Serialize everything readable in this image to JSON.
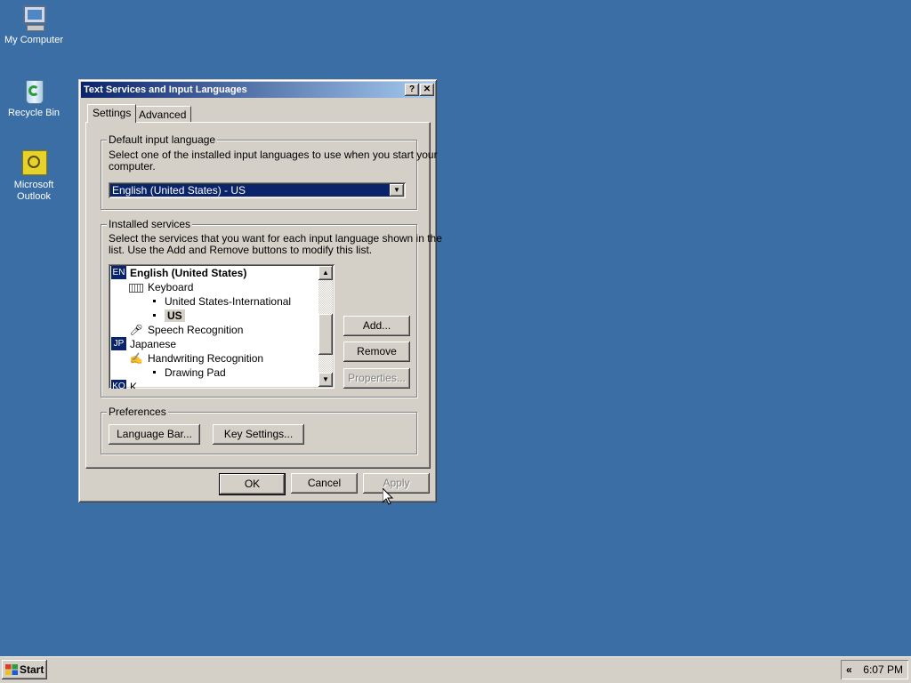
{
  "desktop": {
    "icons": [
      {
        "label": "My Computer",
        "icon": "my-computer-icon"
      },
      {
        "label": "Recycle Bin",
        "icon": "recycle-bin-icon"
      },
      {
        "label_line1": "Microsoft",
        "label_line2": "Outlook",
        "icon": "outlook-icon"
      }
    ]
  },
  "dialog": {
    "title": "Text Services and Input Languages",
    "help_button": "?",
    "close_button": "✕",
    "tabs": [
      {
        "label": "Settings",
        "active": true
      },
      {
        "label": "Advanced",
        "active": false
      }
    ],
    "default_input_group": {
      "title": "Default input language",
      "description_line1": "Select one of the installed input languages to use when you start your",
      "description_line2": "computer.",
      "selected_value": "English (United States) - US"
    },
    "installed_services_group": {
      "title": "Installed services",
      "description_line1": "Select the services that you want for each input language shown in the",
      "description_line2": "list. Use the Add and Remove buttons to modify this list.",
      "tree": [
        {
          "level": 0,
          "badge": "EN",
          "label": "English (United States)",
          "bold": true
        },
        {
          "level": 1,
          "icon": "keyboard-icon",
          "label": "Keyboard"
        },
        {
          "level": 2,
          "label": "United States-International"
        },
        {
          "level": 2,
          "label": "US",
          "selected": true
        },
        {
          "level": 1,
          "icon": "microphone-icon",
          "label": "Speech Recognition"
        },
        {
          "level": 0,
          "badge": "JP",
          "label": "Japanese"
        },
        {
          "level": 1,
          "icon": "pen-icon",
          "label": "Handwriting Recognition"
        },
        {
          "level": 2,
          "label": "Drawing Pad"
        },
        {
          "level": 0,
          "badge": "KO",
          "label": "K..."
        }
      ],
      "add_button": "Add...",
      "remove_button": "Remove",
      "properties_button": "Properties..."
    },
    "preferences_group": {
      "title": "Preferences",
      "language_bar_button": "Language Bar...",
      "key_settings_button": "Key Settings..."
    },
    "ok_button": "OK",
    "cancel_button": "Cancel",
    "apply_button": "Apply"
  },
  "taskbar": {
    "start_label": "Start",
    "tray_chevron": "«",
    "clock": "6:07 PM"
  },
  "colors": {
    "desktop": "#3a6ea5",
    "title_gradient_start": "#0a246a",
    "title_gradient_end": "#a6caf0",
    "face": "#d4d0c8",
    "selection": "#0a246a"
  }
}
